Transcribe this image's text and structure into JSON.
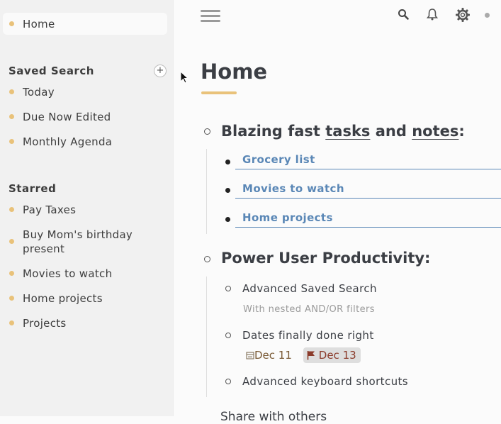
{
  "sidebar": {
    "home": "Home",
    "saved_search": {
      "heading": "Saved Search",
      "add_label": "+",
      "items": [
        "Today",
        "Due Now Edited",
        "Monthly Agenda"
      ]
    },
    "starred": {
      "heading": "Starred",
      "items": [
        "Pay Taxes",
        "Buy Mom's birthday",
        "present",
        "Movies to watch",
        "Home projects",
        "Projects"
      ]
    }
  },
  "topbar": {
    "icons": [
      "menu-icon",
      "search-icon",
      "bell-icon",
      "gear-icon",
      "status-dot"
    ]
  },
  "main": {
    "title": "Home",
    "section1": {
      "prefix": "Blazing fast",
      "word1": "tasks",
      "mid": "and",
      "word2": "notes",
      "suffix": ":",
      "links": [
        "Grocery list",
        "Movies to watch",
        "Home projects"
      ]
    },
    "section2": {
      "heading": "Power User Productivity:",
      "items": [
        {
          "text": "Advanced Saved Search",
          "note": "With nested AND/OR filters"
        },
        {
          "text": "Dates finally done right",
          "date1": "Dec 11",
          "date2": "Dec 13"
        },
        {
          "text": "Advanced keyboard shortcuts"
        }
      ]
    },
    "cut_text": "Share with others"
  },
  "colors": {
    "accent": "#e9c27a",
    "link": "#5a87b6",
    "flag": "#8b3b2b"
  }
}
